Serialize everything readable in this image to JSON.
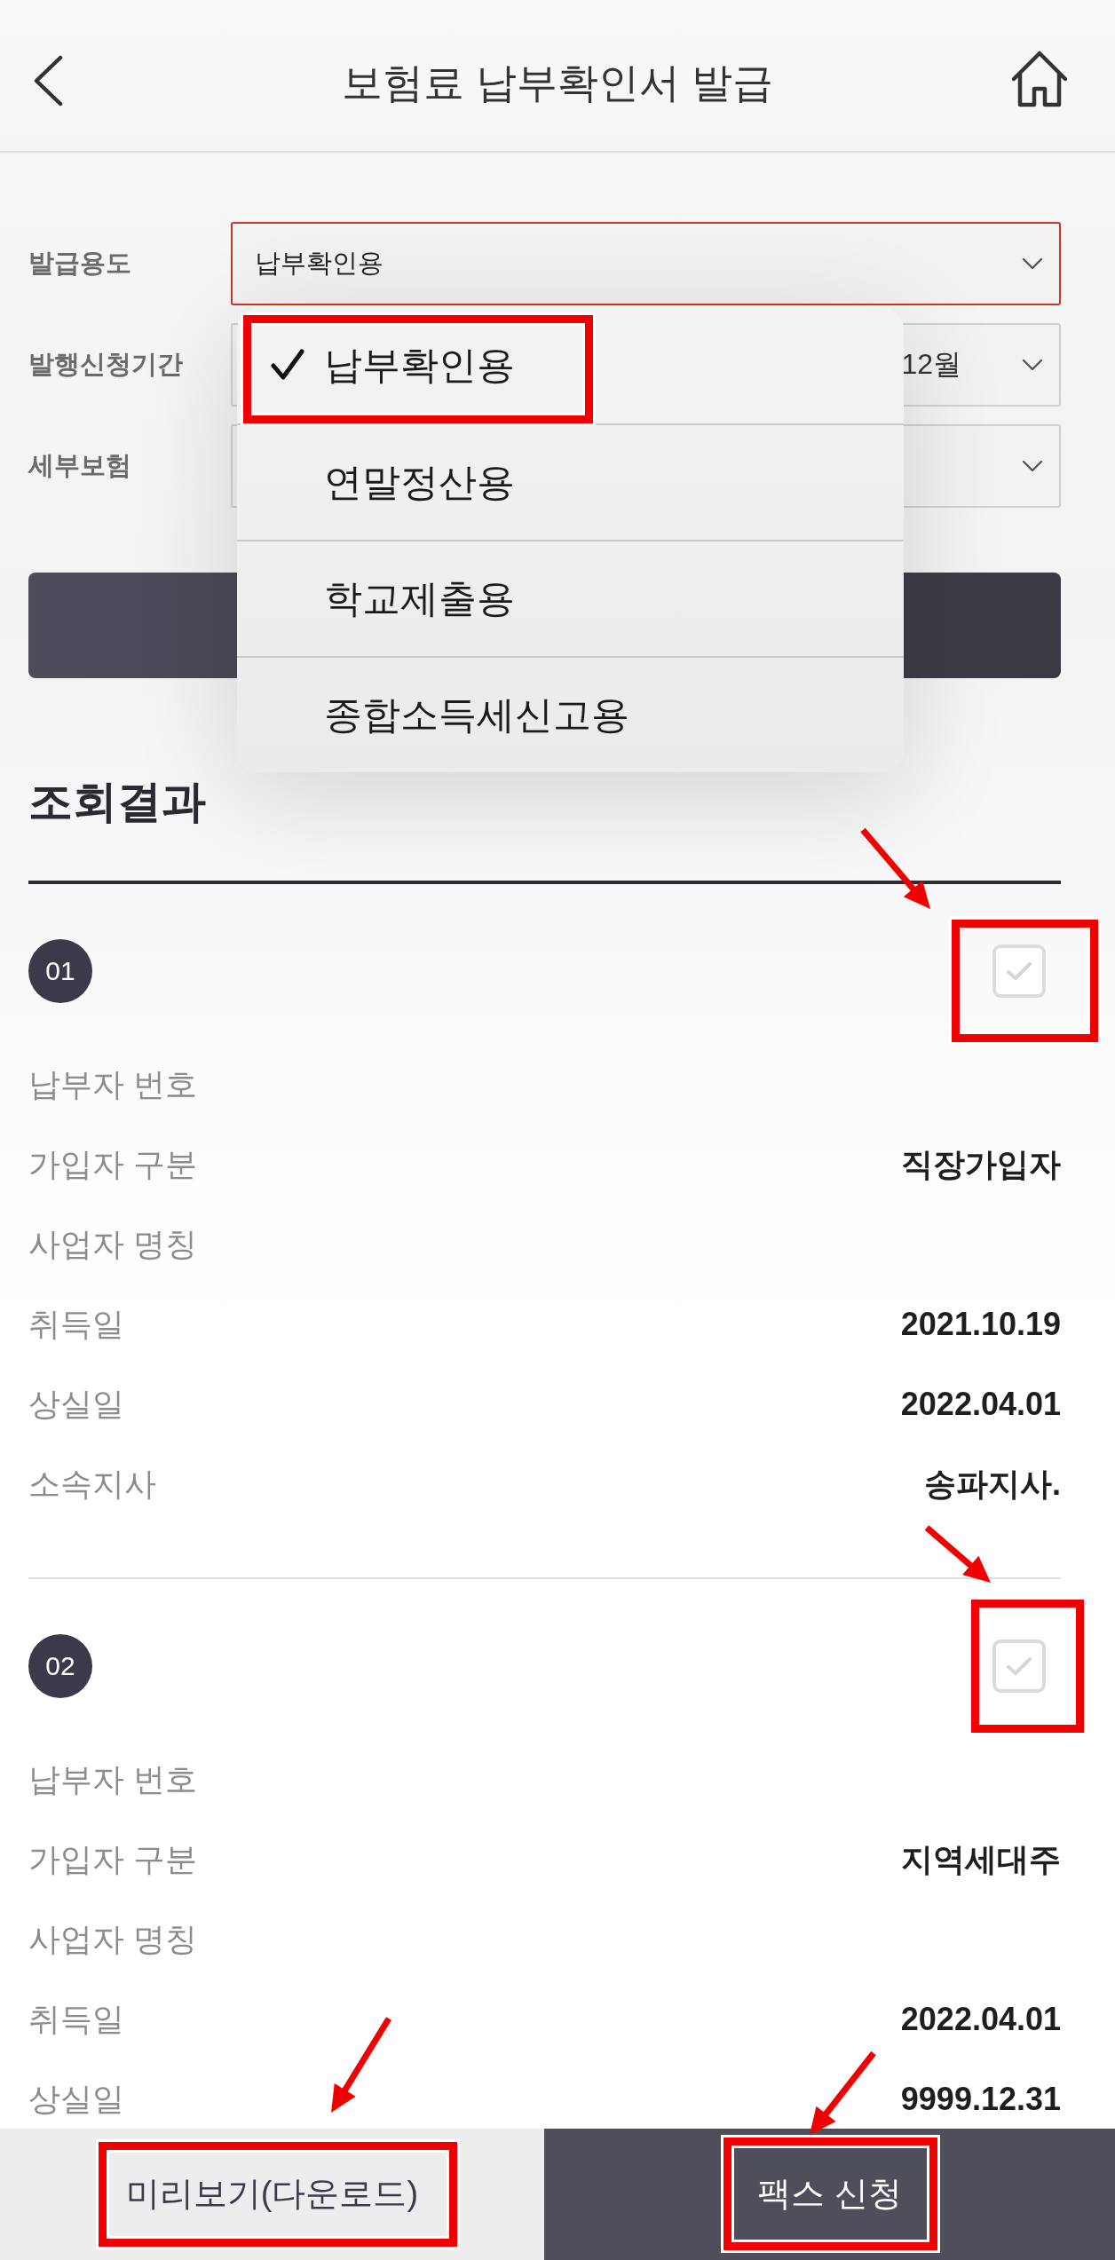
{
  "header": {
    "title": "보험료 납부확인서 발급"
  },
  "form": {
    "fields": [
      {
        "label": "발급용도",
        "value": "납부확인용",
        "focused": true
      },
      {
        "label": "발행신청기간",
        "value": "12월",
        "focused": false
      },
      {
        "label": "세부보험",
        "focused": false
      }
    ],
    "dropdown": {
      "options": [
        {
          "label": "납부확인용",
          "selected": true,
          "highlighted": true
        },
        {
          "label": "연말정산용",
          "selected": false,
          "highlighted": false
        },
        {
          "label": "학교제출용",
          "selected": false,
          "highlighted": false
        },
        {
          "label": "종합소득세신고용",
          "selected": false,
          "highlighted": false
        }
      ]
    }
  },
  "results": {
    "title": "조회결과",
    "items": [
      {
        "number": "01",
        "checked": false,
        "highlighted": true,
        "arrow": true,
        "rows": [
          {
            "label": "납부자 번호"
          },
          {
            "label": "가입자 구분",
            "value": "직장가입자"
          },
          {
            "label": "사업자 명칭"
          },
          {
            "label": "취득일",
            "value": "2021.10.19"
          },
          {
            "label": "상실일",
            "value": "2022.04.01"
          },
          {
            "label": "소속지사",
            "value": "송파지사."
          }
        ]
      },
      {
        "number": "02",
        "checked": false,
        "highlighted": true,
        "arrow": true,
        "rows": [
          {
            "label": "납부자 번호"
          },
          {
            "label": "가입자 구분",
            "value": "지역세대주"
          },
          {
            "label": "사업자 명칭"
          },
          {
            "label": "취득일",
            "value": "2022.04.01"
          },
          {
            "label": "상실일",
            "value": "9999.12.31"
          }
        ]
      }
    ]
  },
  "bottom_bar": {
    "buttons": [
      {
        "label": "미리보기(다운로드)",
        "kind": "secondary",
        "highlighted": true,
        "arrow": true
      },
      {
        "label": "팩스 신청",
        "kind": "primary",
        "highlighted": true,
        "arrow": true
      }
    ]
  }
}
